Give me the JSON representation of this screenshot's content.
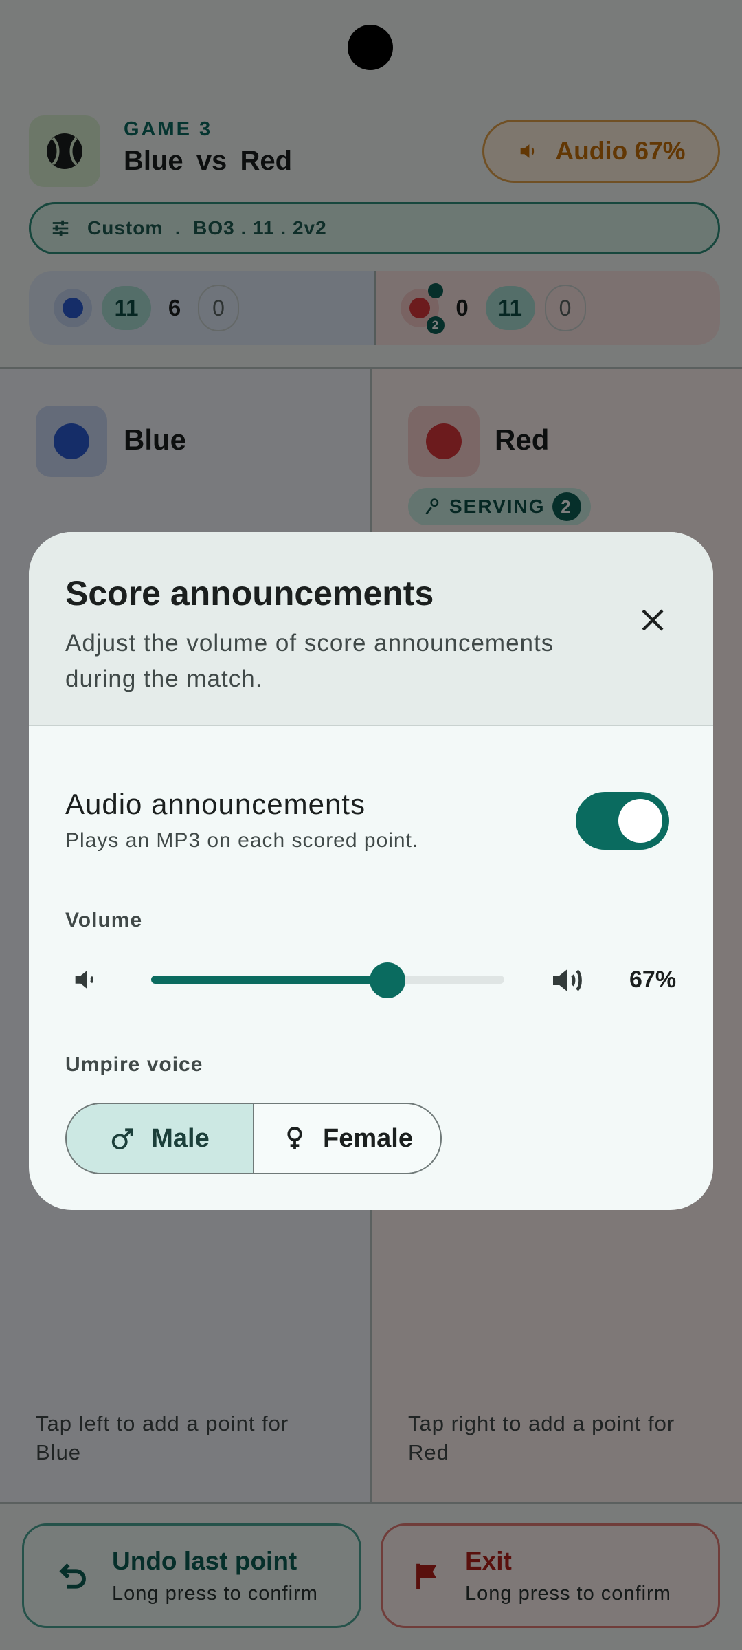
{
  "header": {
    "game_label": "GAME 3",
    "team_a": "Blue",
    "vs": "vs",
    "team_b": "Red",
    "audio_pill": "Audio 67%",
    "format": "Custom  .  BO3 . 11 . 2v2"
  },
  "scorebar": {
    "blue": {
      "games_chip": "11",
      "points": "6",
      "extra": "0"
    },
    "red": {
      "points": "0",
      "games_chip": "11",
      "extra": "0",
      "server_badge": "2"
    }
  },
  "teams": {
    "left": {
      "name": "Blue",
      "color": "#2b5bd0",
      "hint": "Tap left to add a point for Blue"
    },
    "right": {
      "name": "Red",
      "color": "#d9373a",
      "serving_label": "SERVING",
      "serving_number": "2",
      "hint": "Tap right to add a point for Red"
    }
  },
  "bottom": {
    "undo_title": "Undo last point",
    "undo_sub": "Long press to confirm",
    "exit_title": "Exit",
    "exit_sub": "Long press to confirm"
  },
  "dialog": {
    "title": "Score announcements",
    "subtitle": "Adjust the volume of score announcements during the match.",
    "audio_title": "Audio announcements",
    "audio_sub": "Plays an MP3 on each scored point.",
    "audio_enabled": true,
    "volume_label": "Volume",
    "volume_value": 0.67,
    "volume_text": "67%",
    "voice_label": "Umpire voice",
    "voice_options": [
      "Male",
      "Female"
    ],
    "voice_selected": "Male"
  },
  "colors": {
    "accent": "#0a6b5f",
    "blue": "#2b5bd0",
    "red": "#d9373a",
    "warning": "#c46f08"
  }
}
